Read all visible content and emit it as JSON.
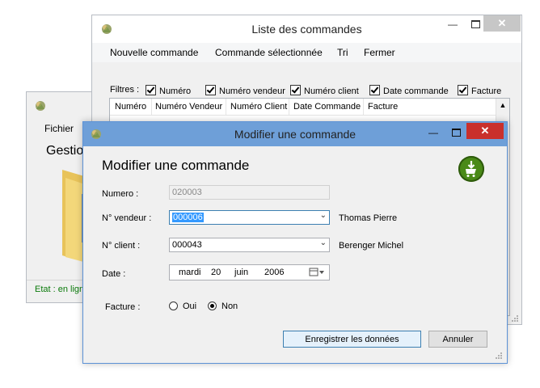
{
  "main_window": {
    "menu_file": "Fichier",
    "heading": "Gestion",
    "status": "Etat : en ligne"
  },
  "list_window": {
    "title": "Liste des commandes",
    "menu": [
      "Nouvelle commande",
      "Commande sélectionnée",
      "Tri",
      "Fermer"
    ],
    "filters_label": "Filtres :",
    "filters": [
      "Numéro",
      "Numéro vendeur",
      "Numéro client",
      "Date commande",
      "Facture"
    ],
    "columns": [
      "Numéro",
      "Numéro Vendeur",
      "Numéro Client",
      "Date Commande",
      "Facture"
    ]
  },
  "edit_window": {
    "title": "Modifier une commande",
    "heading": "Modifier une commande",
    "numero_label": "Numero :",
    "numero_value": "020003",
    "vendeur_label": "N° vendeur :",
    "vendeur_value": "000006",
    "vendeur_name": "Thomas Pierre",
    "client_label": "N° client :",
    "client_value": "000043",
    "client_name": "Berenger Michel",
    "date_label": "Date :",
    "date_day": "mardi",
    "date_num": "20",
    "date_month": "juin",
    "date_year": "2006",
    "facture_label": "Facture :",
    "radio_oui": "Oui",
    "radio_non": "Non",
    "facture_selected": "Non",
    "save_button": "Enregistrer les données",
    "cancel_button": "Annuler"
  },
  "colors": {
    "active_title": "#6e9fd8",
    "close_red": "#c9302c",
    "status_green": "#0a7a0a",
    "selection_blue": "#3399ff"
  }
}
